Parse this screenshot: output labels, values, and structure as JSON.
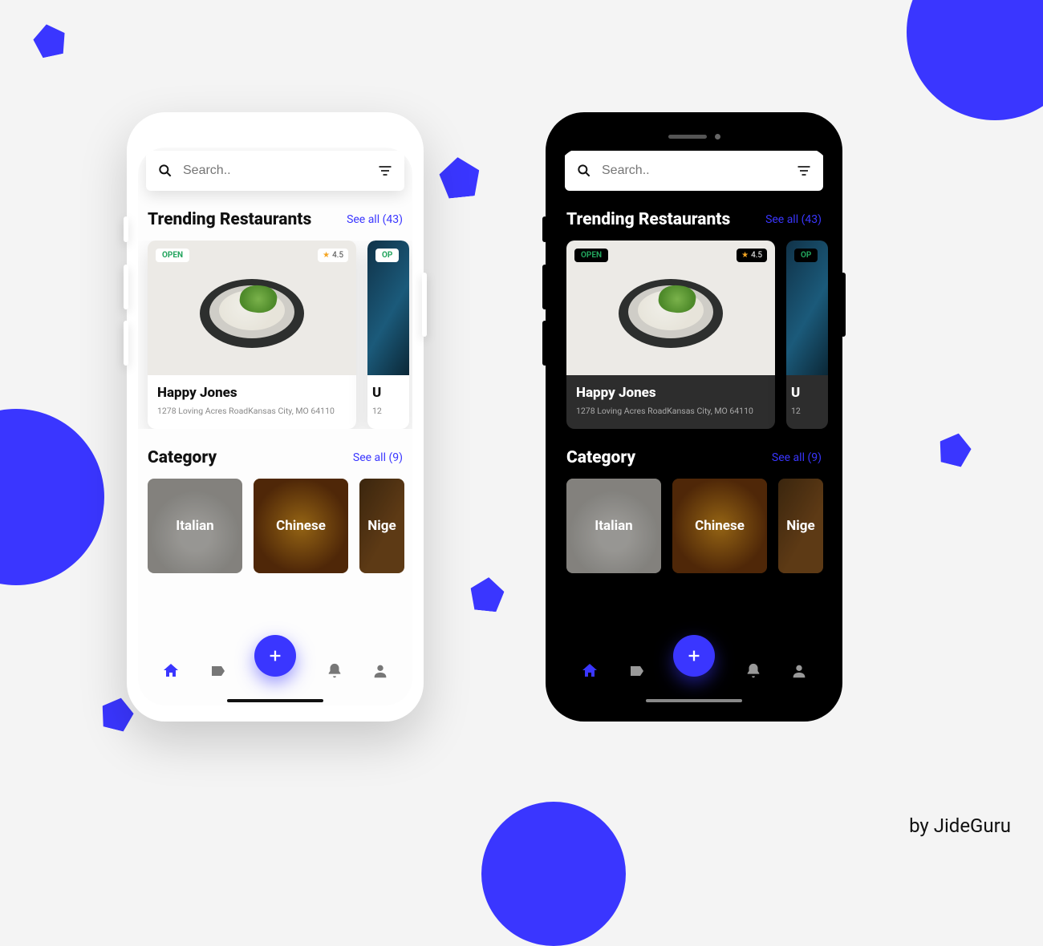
{
  "colors": {
    "accent": "#3a36ff",
    "open_status": "#22a45d",
    "star": "#f5a623"
  },
  "attribution": "by JideGuru",
  "search": {
    "placeholder": "Search.."
  },
  "sections": {
    "trending": {
      "title": "Trending Restaurants",
      "see_all_label": "See all (43)",
      "count": 43
    },
    "category": {
      "title": "Category",
      "see_all_label": "See all (9)",
      "count": 9
    }
  },
  "restaurants": [
    {
      "name": "Happy Jones",
      "address": "1278 Loving Acres RoadKansas City, MO 64110",
      "status": "OPEN",
      "rating": "4.5"
    },
    {
      "name": "U",
      "address": "12",
      "status": "OP",
      "rating": ""
    }
  ],
  "categories": [
    {
      "label": "Italian"
    },
    {
      "label": "Chinese"
    },
    {
      "label": "Nige"
    }
  ],
  "nav_icons": {
    "home": "home-icon",
    "tag": "tag-icon",
    "add": "plus-icon",
    "bell": "bell-icon",
    "person": "person-icon"
  }
}
